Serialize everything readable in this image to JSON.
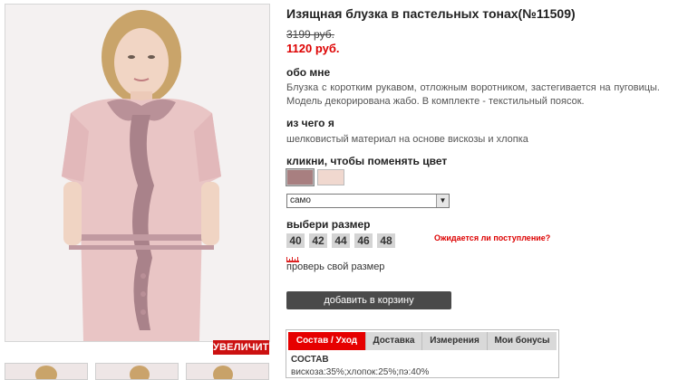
{
  "product": {
    "title": "Изящная блузка в пастельных тонах(№11509)",
    "old_price": "3199 руб.",
    "new_price": "1120 руб.",
    "zoom_label": "УВЕЛИЧИТЬ"
  },
  "about": {
    "heading": "обо мне",
    "text": "Блузка с коротким рукавом, отложным воротником, застегивается на пуговицы. Модель декорирована жабо. В комплекте - текстильный поясок."
  },
  "material": {
    "heading": "из чего я",
    "text": "шелковистый материал на основе вискозы и хлопка"
  },
  "color": {
    "heading": "кликни, чтобы поменять цвет",
    "swatches": [
      "#a87f80",
      "#f0d8cf"
    ],
    "selected_value": "само"
  },
  "size": {
    "heading": "выбери размер",
    "options": [
      "40",
      "42",
      "44",
      "46",
      "48"
    ],
    "availability_link": "Ожидается ли поступление?",
    "check_link": "проверь свой размер"
  },
  "cart": {
    "button_label": "добавить в корзину"
  },
  "tabs": {
    "items": [
      {
        "label": "Состав / Уход",
        "active": true
      },
      {
        "label": "Доставка",
        "active": false
      },
      {
        "label": "Измерения",
        "active": false
      },
      {
        "label": "Мои бонусы",
        "active": false
      }
    ],
    "content_heading": "СОСТАВ",
    "content_value": "вискоза:35%;хлопок:25%;пэ:40%"
  },
  "colors": {
    "accent_red": "#dd0000",
    "button_dark": "#4a4a4a",
    "size_box_bg": "#d4d4d4"
  }
}
